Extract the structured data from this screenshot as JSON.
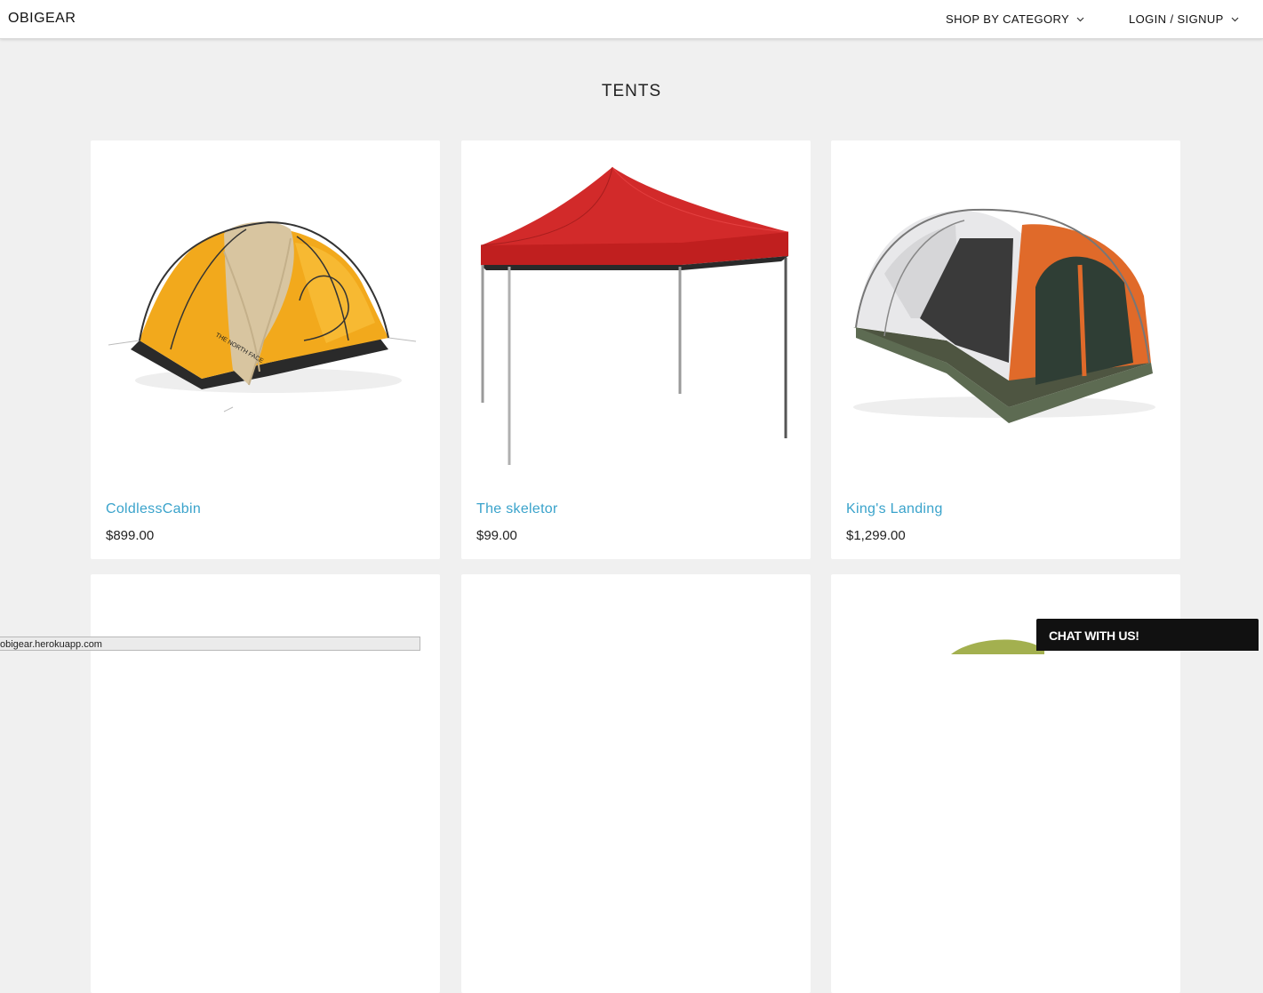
{
  "header": {
    "brand": "OBIGEAR",
    "nav": [
      {
        "label": "SHOP BY CATEGORY"
      },
      {
        "label": "LOGIN / SIGNUP"
      }
    ]
  },
  "page": {
    "title": "TENTS"
  },
  "products": [
    {
      "name": "ColdlessCabin",
      "price": "$899.00"
    },
    {
      "name": "The skeletor",
      "price": "$99.00"
    },
    {
      "name": "King's Landing",
      "price": "$1,299.00"
    }
  ],
  "status_bar": {
    "url": "obigear.herokuapp.com"
  },
  "chat": {
    "label": "CHAT WITH US!"
  },
  "colors": {
    "background": "#f0f0f0",
    "product_link": "#3aa3cb",
    "chat_bg": "#111111"
  }
}
